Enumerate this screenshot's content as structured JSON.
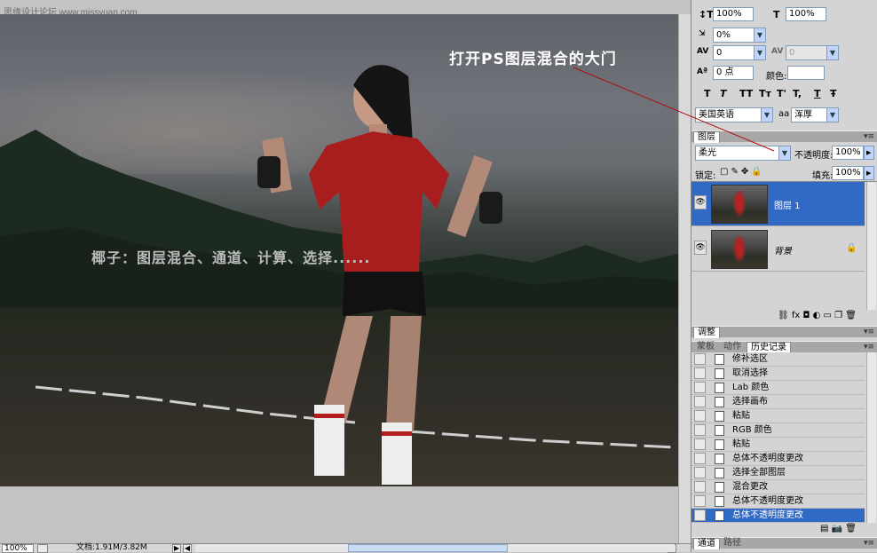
{
  "watermark": "思缘设计论坛  www.missyuan.com",
  "canvas": {
    "caption_main": "打开PS图层混合的大门",
    "caption_sub": "椰子：图层混合、通道、计算、选择......"
  },
  "statusbar": {
    "zoom": "100%",
    "doc_info": "文档:1.91M/3.82M"
  },
  "character_panel": {
    "vscale": "100%",
    "hscale": "100%",
    "tracking_ratio": "0%",
    "tracking": "0",
    "kerning_value": "0",
    "baseline_shift": "0 点",
    "color_label": "颜色:",
    "language": "美国英语",
    "aa_label": "aa",
    "antialias": "浑厚",
    "style_buttons": [
      "T",
      "T",
      "TT",
      "Tт",
      "T'",
      "T,",
      "T",
      "Ŧ"
    ]
  },
  "layers_panel": {
    "tab": "图层",
    "blend_mode": "柔光",
    "opacity_label": "不透明度:",
    "opacity": "100%",
    "lock_label": "锁定:",
    "fill_label": "填充:",
    "fill": "100%",
    "layers": [
      {
        "name": "图层 1",
        "selected": true
      },
      {
        "name": "背景",
        "selected": false
      }
    ],
    "footer_icons": [
      "link-icon",
      "fx-icon",
      "mask-icon",
      "adjustment-icon",
      "group-icon",
      "new-layer-icon",
      "trash-icon"
    ]
  },
  "adjust_panel": {
    "tab": "调整"
  },
  "history_panel": {
    "tabs": [
      "蒙板",
      "动作",
      "历史记录"
    ],
    "active_tab": "历史记录",
    "items": [
      "修补选区",
      "取消选择",
      "Lab 颜色",
      "选择画布",
      "粘贴",
      "RGB 颜色",
      "粘贴",
      "总体不透明度更改",
      "选择全部图层",
      "混合更改",
      "总体不透明度更改",
      "总体不透明度更改"
    ],
    "selected_index": 11
  },
  "channels_panel": {
    "tabs": [
      "通道",
      "路径"
    ]
  },
  "colors": {
    "selection": "#316ac5",
    "annotation_line": "#b01010"
  }
}
